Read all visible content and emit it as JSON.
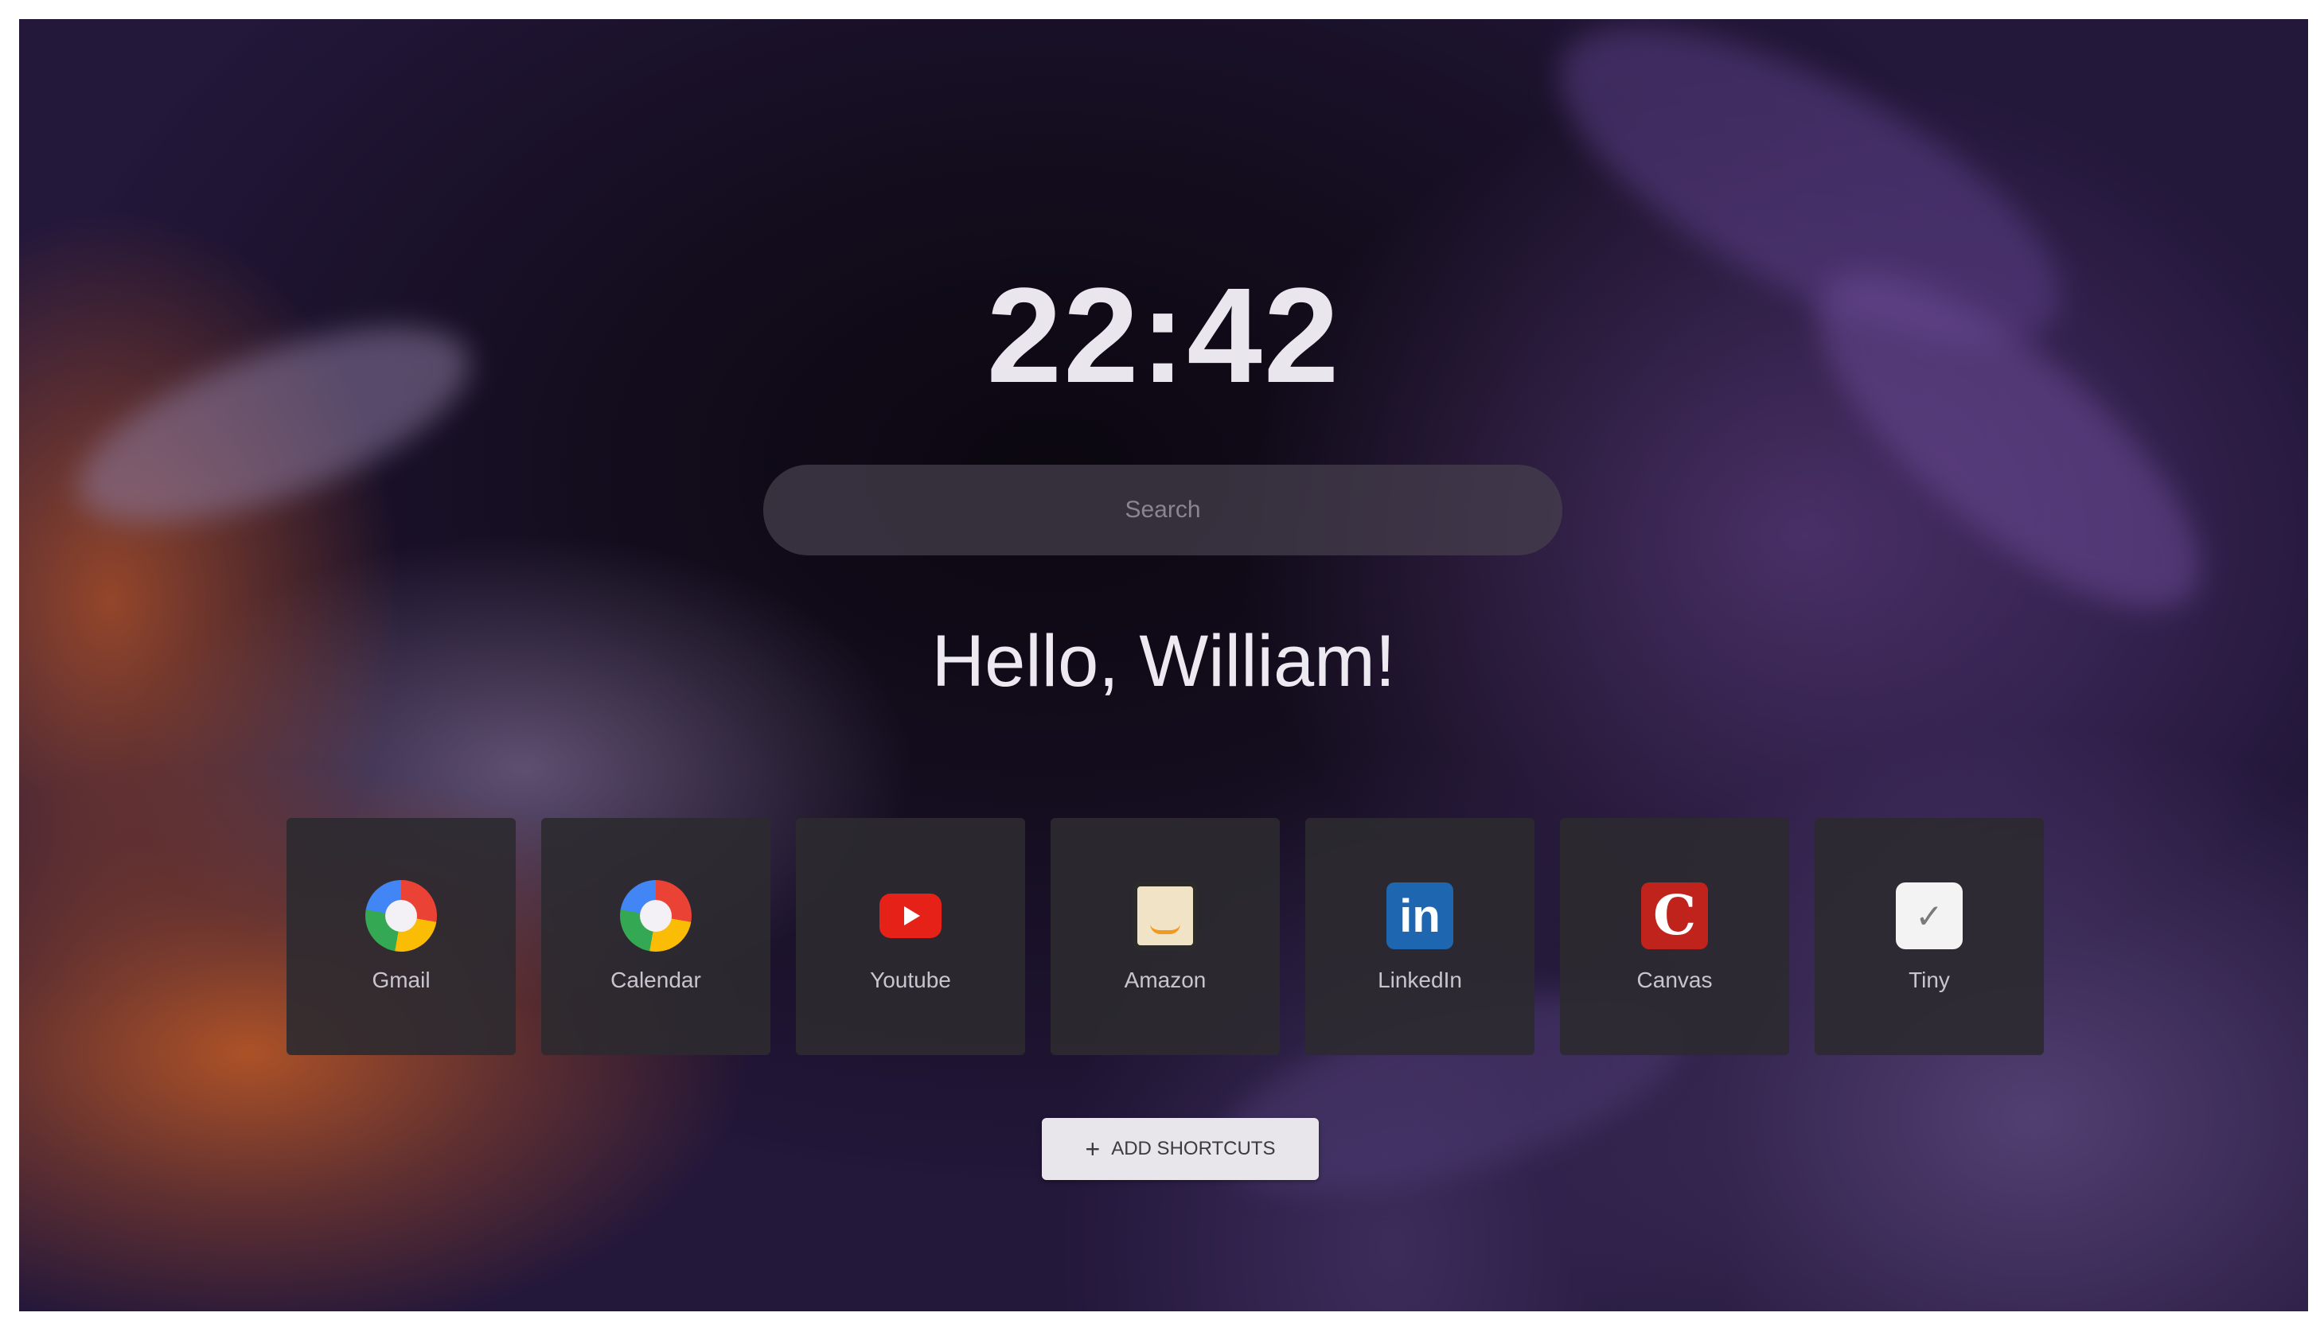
{
  "clock": {
    "time": "22:42"
  },
  "search": {
    "placeholder": "Search"
  },
  "greeting": {
    "text": "Hello, William!"
  },
  "shortcuts": [
    {
      "label": "Gmail",
      "icon": "google-icon"
    },
    {
      "label": "Calendar",
      "icon": "google-icon"
    },
    {
      "label": "Youtube",
      "icon": "youtube-icon"
    },
    {
      "label": "Amazon",
      "icon": "amazon-icon"
    },
    {
      "label": "LinkedIn",
      "icon": "linkedin-icon"
    },
    {
      "label": "Canvas",
      "icon": "canvas-icon"
    },
    {
      "label": "Tiny",
      "icon": "tiny-icon"
    }
  ],
  "icon_glyphs": {
    "linkedin": "in",
    "canvas": "C",
    "tiny": "✓"
  },
  "add_shortcuts": {
    "label": "ADD SHORTCUTS",
    "icon": "plus-icon",
    "glyph": "+"
  },
  "colors": {
    "youtube_red": "#e62117",
    "linkedin_blue": "#1e66b0",
    "canvas_red": "#c0231c",
    "tile_bg": "#2c2a30"
  }
}
